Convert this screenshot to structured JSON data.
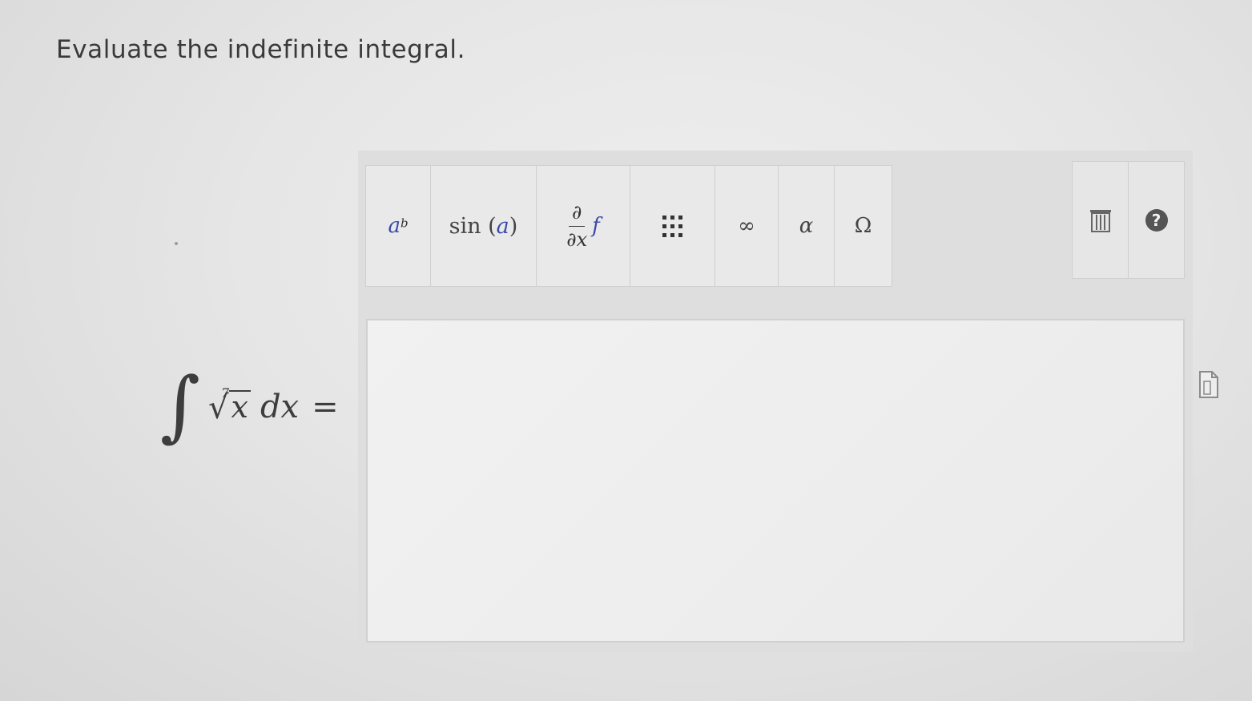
{
  "question": {
    "text": "Evaluate the indefinite integral."
  },
  "problem": {
    "integral_sign": "∫",
    "root_index": "7",
    "root_sign": "√",
    "radicand": "x",
    "differential": "dx",
    "equals": "="
  },
  "toolbar": {
    "power": {
      "base": "a",
      "exponent": "b"
    },
    "trig": {
      "prefix": "sin (",
      "arg": "a",
      "suffix": ")"
    },
    "derivative": {
      "numerator": "∂",
      "denominator": "∂x",
      "function": "f"
    },
    "infinity": "∞",
    "alpha": "α",
    "omega": "Ω",
    "help": "?"
  },
  "answer": {
    "value": ""
  },
  "icons": {
    "power": "exponent-icon",
    "trig": "trig-function-icon",
    "derivative": "partial-derivative-icon",
    "matrix": "matrix-icon",
    "trash": "trash-icon",
    "help": "help-icon",
    "document": "document-icon"
  },
  "colors": {
    "variable_blue": "#3b4aa8"
  }
}
